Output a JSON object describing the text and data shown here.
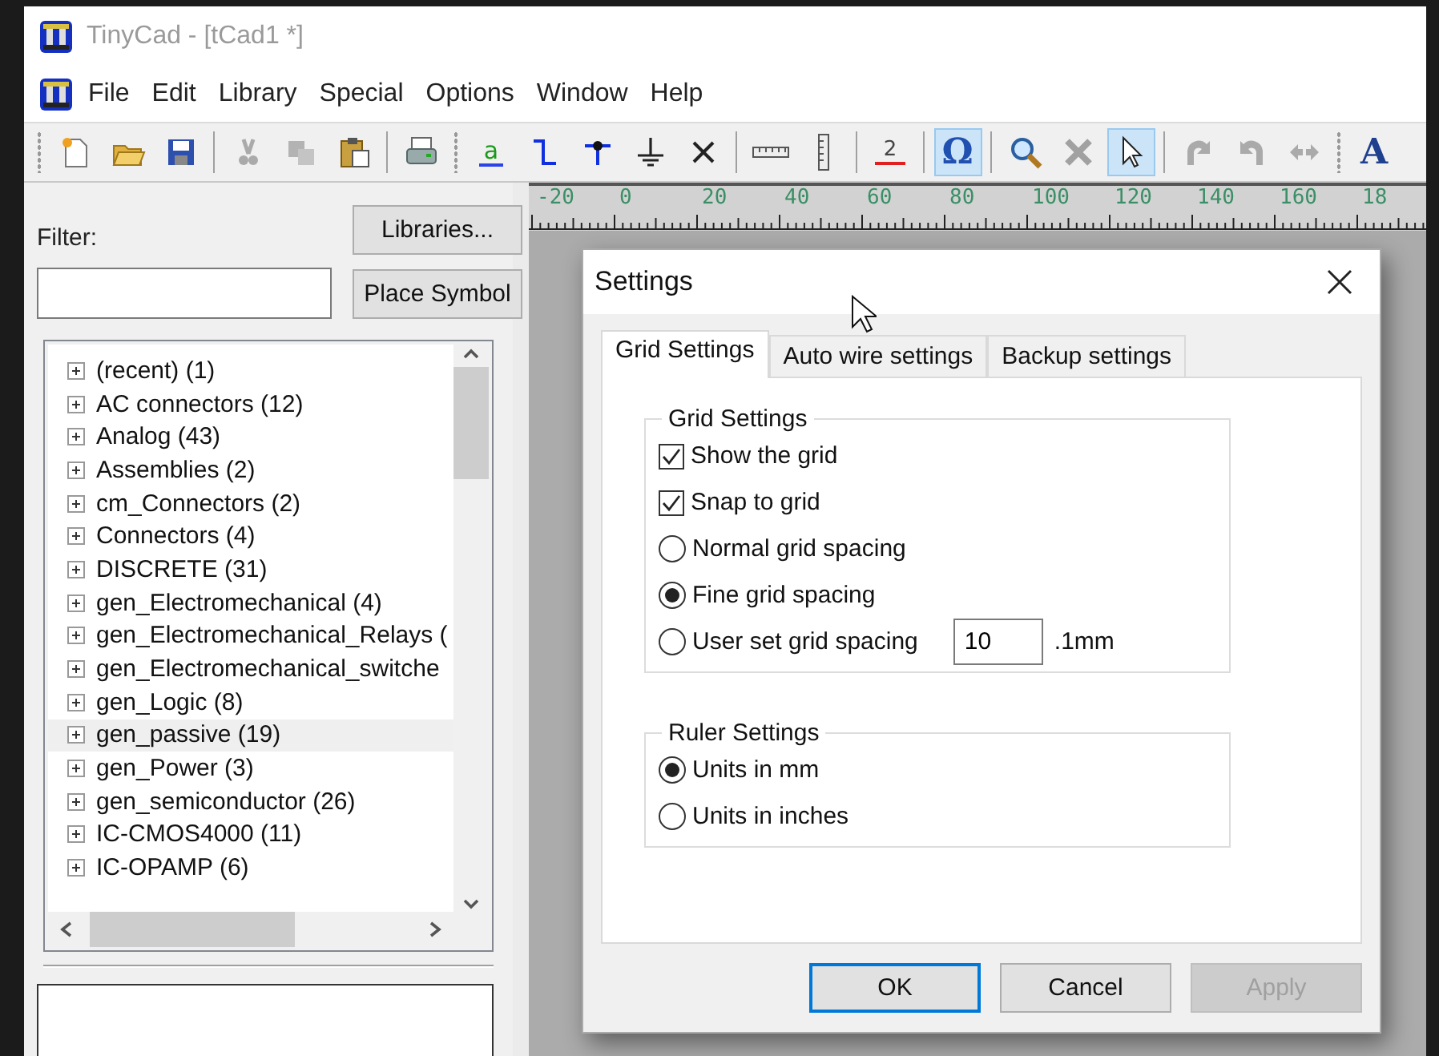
{
  "window": {
    "title": "TinyCad - [tCad1 *]"
  },
  "menu": [
    "File",
    "Edit",
    "Library",
    "Special",
    "Options",
    "Window",
    "Help"
  ],
  "toolbar": {
    "groups": [
      [
        {
          "disabled": false,
          "selected": false
        },
        {
          "disabled": false,
          "selected": false
        },
        {
          "disabled": false,
          "selected": false
        }
      ],
      [
        {
          "disabled": true,
          "selected": false
        },
        {
          "disabled": true,
          "selected": false
        },
        {
          "disabled": false,
          "selected": false
        }
      ],
      [
        {
          "disabled": false,
          "selected": false
        }
      ],
      [
        {
          "label": "a",
          "disabled": false,
          "selected": false
        },
        {
          "disabled": false,
          "selected": false
        },
        {
          "disabled": false,
          "selected": false
        },
        {
          "disabled": false,
          "selected": false
        },
        {
          "disabled": false,
          "selected": false
        }
      ],
      [
        {
          "disabled": false,
          "selected": false
        },
        {
          "disabled": false,
          "selected": false
        }
      ],
      [
        {
          "label": "2",
          "disabled": false,
          "selected": false
        }
      ],
      [
        {
          "label": "Ω",
          "disabled": false,
          "selected": true
        }
      ],
      [
        {
          "disabled": false,
          "selected": false
        },
        {
          "disabled": true,
          "selected": false
        },
        {
          "disabled": false,
          "selected": true
        }
      ],
      [
        {
          "disabled": true,
          "selected": false
        },
        {
          "disabled": true,
          "selected": false
        },
        {
          "disabled": true,
          "selected": false
        }
      ],
      [
        {
          "label": "A",
          "disabled": false,
          "selected": false
        }
      ]
    ]
  },
  "library_panel": {
    "filter_label": "Filter:",
    "buttons": [
      "Libraries...",
      "Place Symbol"
    ],
    "tree": [
      {
        "label": "(recent) (1)",
        "selected": false
      },
      {
        "label": "AC connectors (12)",
        "selected": false
      },
      {
        "label": "Analog (43)",
        "selected": false
      },
      {
        "label": "Assemblies (2)",
        "selected": false
      },
      {
        "label": "cm_Connectors (2)",
        "selected": false
      },
      {
        "label": "Connectors (4)",
        "selected": false
      },
      {
        "label": "DISCRETE (31)",
        "selected": false
      },
      {
        "label": "gen_Electromechanical (4)",
        "selected": false
      },
      {
        "label": "gen_Electromechanical_Relays (",
        "selected": false
      },
      {
        "label": "gen_Electromechanical_switche",
        "selected": false
      },
      {
        "label": "gen_Logic (8)",
        "selected": false
      },
      {
        "label": "gen_passive (19)",
        "selected": true
      },
      {
        "label": "gen_Power (3)",
        "selected": false
      },
      {
        "label": "gen_semiconductor (26)",
        "selected": false
      },
      {
        "label": "IC-CMOS4000 (11)",
        "selected": false
      },
      {
        "label": "IC-OPAMP (6)",
        "selected": false
      }
    ]
  },
  "ruler": {
    "labels": [
      "-20",
      "0",
      "20",
      "40",
      "60",
      "80",
      "100",
      "120",
      "140",
      "160",
      "18"
    ]
  },
  "dialog": {
    "title": "Settings",
    "tabs": [
      {
        "label": "Grid Settings",
        "selected": true
      },
      {
        "label": "Auto wire settings",
        "selected": false
      },
      {
        "label": "Backup settings",
        "selected": false
      }
    ],
    "groups": [
      {
        "title": "Grid Settings",
        "options": [
          {
            "kind": "checkbox",
            "label": "Show the grid",
            "checked": true
          },
          {
            "kind": "checkbox",
            "label": "Snap to grid",
            "checked": true
          },
          {
            "kind": "radio",
            "label": "Normal grid spacing",
            "checked": false
          },
          {
            "kind": "radio",
            "label": "Fine grid spacing",
            "checked": true
          },
          {
            "kind": "radio",
            "label": "User set grid spacing",
            "checked": false,
            "value": "10",
            "unit": ".1mm"
          }
        ]
      },
      {
        "title": "Ruler Settings",
        "options": [
          {
            "kind": "radio",
            "label": "Units in mm",
            "checked": true
          },
          {
            "kind": "radio",
            "label": "Units in inches",
            "checked": false
          }
        ]
      }
    ],
    "buttons": [
      {
        "label": "OK",
        "default": true,
        "disabled": false
      },
      {
        "label": "Cancel",
        "default": false,
        "disabled": false
      },
      {
        "label": "Apply",
        "default": false,
        "disabled": true
      }
    ]
  }
}
